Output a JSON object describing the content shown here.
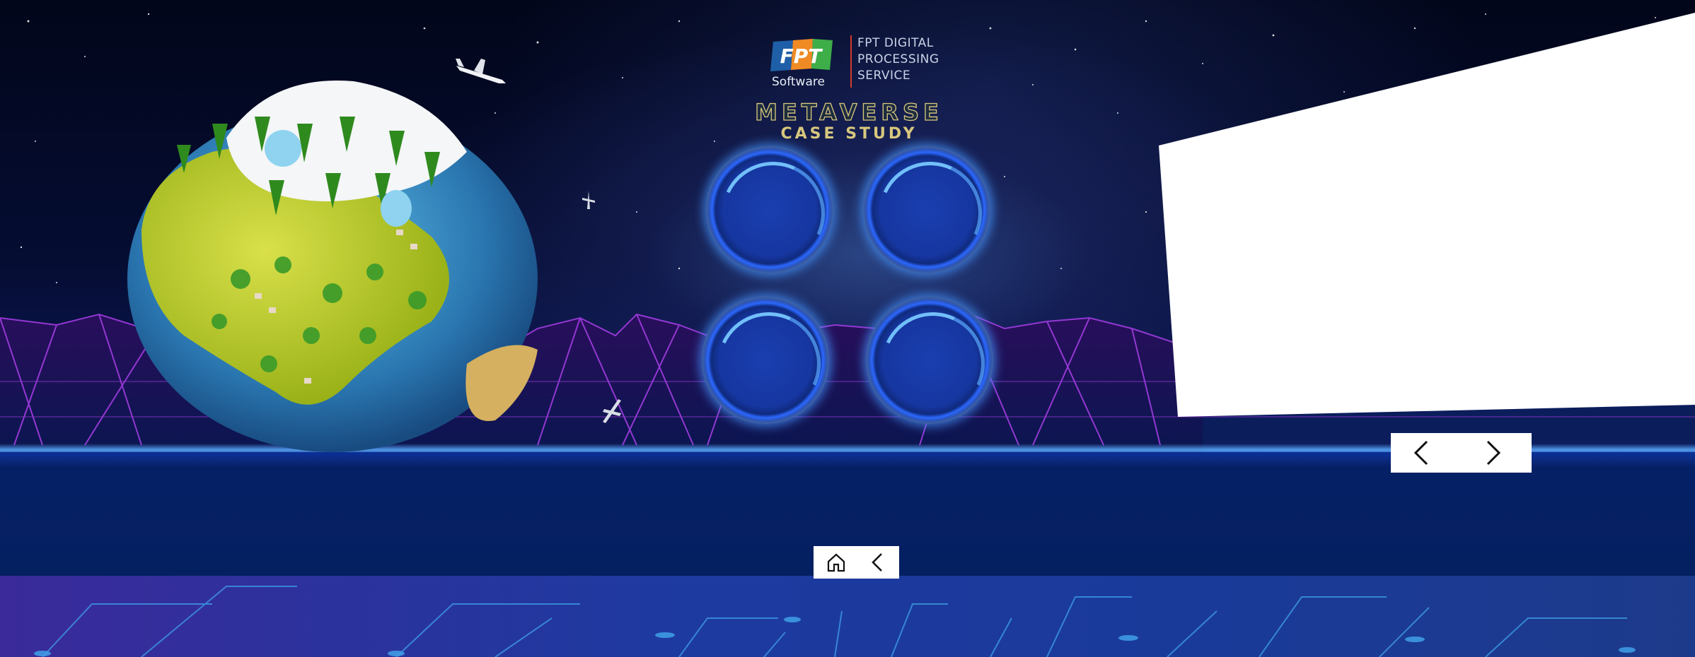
{
  "logo": {
    "badge_letters": "FPT",
    "software_label": "Software",
    "division_text": "FPT DIGITAL\nPROCESSING\nSERVICE"
  },
  "title": {
    "main": "METAVERSE",
    "sub": "CASE STUDY"
  },
  "case_buttons": [
    "case-study-1",
    "case-study-2",
    "case-study-3",
    "case-study-4"
  ],
  "panel_nav": {
    "prev_icon": "chevron-left-icon",
    "next_icon": "chevron-right-icon"
  },
  "footer_nav": {
    "home_icon": "home-icon",
    "back_icon": "chevron-left-icon"
  },
  "colors": {
    "sky": "#050d33",
    "neon_purple": "#9b3bd6",
    "orb_blue": "#2a66ff",
    "title_gold": "#d8c77e",
    "floor": "#062066"
  }
}
